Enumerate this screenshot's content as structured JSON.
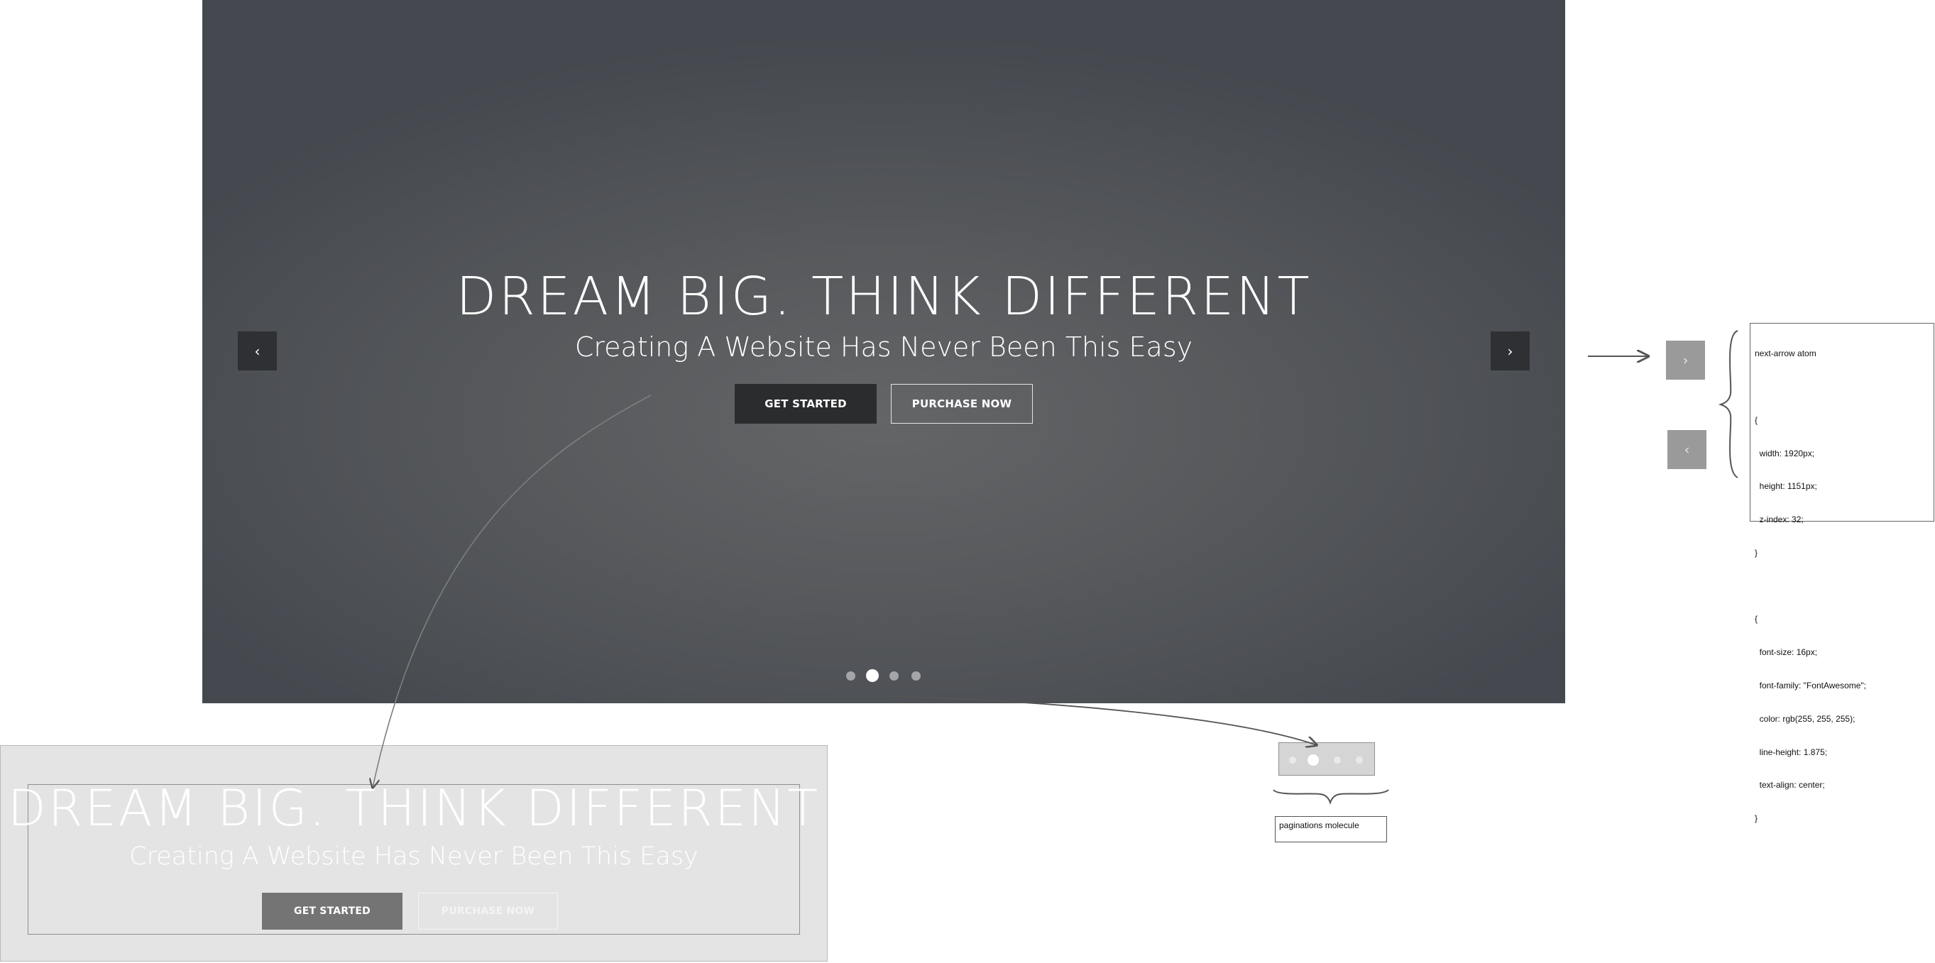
{
  "hero": {
    "title": "DREAM BIG. THINK DIFFERENT",
    "subtitle": "Creating A Website Has Never Been This Easy",
    "primary_button": "GET STARTED",
    "secondary_button": "PURCHASE NOW",
    "prev_arrow": "‹",
    "next_arrow": "›",
    "slide_count": 4,
    "active_slide": 2
  },
  "organism_preview": {
    "title": "DREAM BIG. THINK DIFFERENT",
    "subtitle": "Creating A Website Has Never Been This Easy",
    "primary_button": "GET STARTED",
    "secondary_button": "PURCHASE NOW"
  },
  "pagination_molecule": {
    "label": "paginations molecule",
    "dot_count": 4,
    "active_dot": 2
  },
  "arrow_atom": {
    "next_arrow": "›",
    "prev_arrow": "‹",
    "code_lines": [
      "next-arrow atom",
      "",
      "{",
      "  width: 1920px;",
      "  height: 1151px;",
      "  z-index: 32;",
      "}",
      "",
      "{",
      "  font-size: 16px;",
      "  font-family: \"FontAwesome\";",
      "  color: rgb(255, 255, 255);",
      "  line-height: 1.875;",
      "  text-align: center;",
      "}"
    ]
  },
  "colors": {
    "hero_dark": "#45494f",
    "hero_mid": "#646567",
    "button_dark": "#2b2c2e",
    "atom_gray": "#9a9a9a",
    "preview_bg": "#e4e4e4"
  }
}
